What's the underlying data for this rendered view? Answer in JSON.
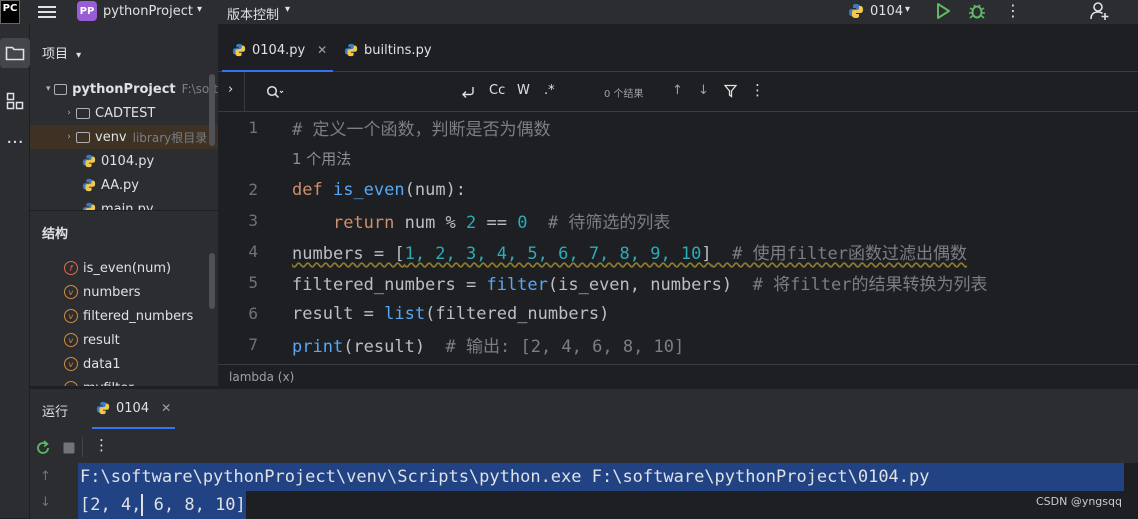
{
  "titlebar": {
    "logo_text": "PC",
    "project_badge": "PP",
    "project_name": "pythonProject",
    "vcs_label": "版本控制",
    "run_config": "0104"
  },
  "project_panel": {
    "title": "项目",
    "tree": [
      {
        "label": "pythonProject",
        "hint": "F:\\soft",
        "type": "folder",
        "expanded": true,
        "level": 0
      },
      {
        "label": "CADTEST",
        "hint": "",
        "type": "folder",
        "expanded": false,
        "level": 1
      },
      {
        "label": "venv",
        "hint": "library根目录",
        "type": "folder",
        "expanded": false,
        "level": 1
      },
      {
        "label": "0104.py",
        "hint": "",
        "type": "py",
        "level": 1
      },
      {
        "label": "AA.py",
        "hint": "",
        "type": "py",
        "level": 1
      },
      {
        "label": "main.py",
        "hint": "",
        "type": "py",
        "level": 1
      }
    ]
  },
  "structure_panel": {
    "title": "结构",
    "items": [
      {
        "kind": "f",
        "label": "is_even(num)"
      },
      {
        "kind": "v",
        "label": "numbers"
      },
      {
        "kind": "v",
        "label": "filtered_numbers"
      },
      {
        "kind": "v",
        "label": "result"
      },
      {
        "kind": "v",
        "label": "data1"
      },
      {
        "kind": "v",
        "label": "myfilter"
      }
    ]
  },
  "editor": {
    "tabs": [
      {
        "label": "0104.py",
        "active": true
      },
      {
        "label": "builtins.py",
        "active": false
      }
    ],
    "find": {
      "case_label": "Cc",
      "word_label": "W",
      "regex_label": ".*",
      "results": "0 个结果"
    },
    "lines": {
      "l1_no": "1",
      "l1_comment": "# 定义一个函数，判断是否为偶数",
      "usage_hint": "1 个用法",
      "l2_no": "2",
      "l2_def": "def",
      "l2_name": "is_even",
      "l2_rest": "(num):",
      "l3_no": "3",
      "l3_return": "return",
      "l3_a": " num % ",
      "l3_two": "2",
      "l3_b": " == ",
      "l3_zero": "0",
      "l3_comment": "  # 待筛选的列表",
      "l4_no": "4",
      "l4_a": "numbers = [",
      "l4_nums": "1, 2, 3, 4, 5, 6, 7, 8, 9, 10",
      "l4_b": "]",
      "l4_comment": "  # 使用filter函数过滤出偶数",
      "l5_no": "5",
      "l5_a": "filtered_numbers = ",
      "l5_fn": "filter",
      "l5_b": "(is_even, numbers)",
      "l5_comment": "  # 将filter的结果转换为列表",
      "l6_no": "6",
      "l6_a": "result = ",
      "l6_fn": "list",
      "l6_b": "(filtered_numbers)",
      "l7_no": "7",
      "l7_fn": "print",
      "l7_b": "(result)",
      "l7_comment": "  # 输出: [2, 4, 6, 8, 10]"
    },
    "breadcrumb": "lambda (x)"
  },
  "run_panel": {
    "title": "运行",
    "tab_label": "0104",
    "console": {
      "line1": "F:\\software\\pythonProject\\venv\\Scripts\\python.exe F:\\software\\pythonProject\\0104.py",
      "line2_a": "[2, 4,",
      "line2_b": " 6, 8, 10]"
    }
  },
  "watermark": "CSDN @yngsqq",
  "colors": {
    "accent": "#3574f0",
    "keyword": "#cf8e6d",
    "function": "#56a8f5",
    "number": "#2aacb8",
    "comment": "#7a7e85",
    "selection": "#214283"
  }
}
